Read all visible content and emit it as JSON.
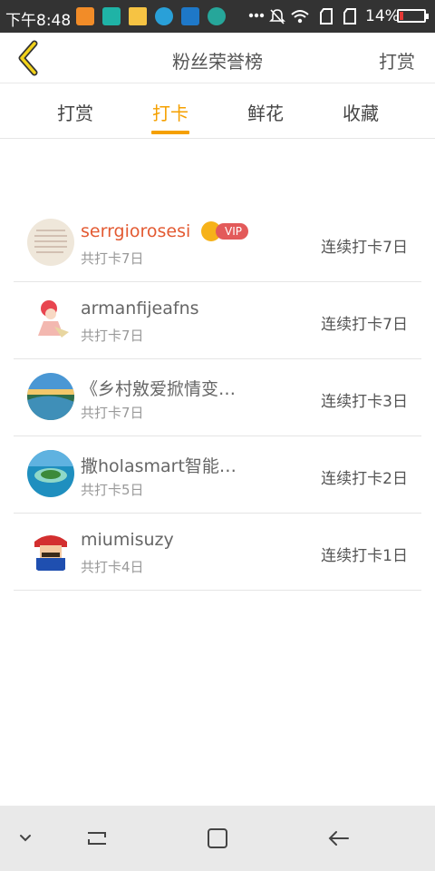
{
  "status_bar": {
    "time": "下午8:48",
    "battery_percent": "14%",
    "battery_level": 0.14,
    "colors": {
      "app1": "#f28c28",
      "app2": "#1fb3a6",
      "folder": "#f6c343",
      "palette": "#29a0d8",
      "weather": "#1e78c8",
      "app6": "#26a69a"
    }
  },
  "header": {
    "title": "粉丝荣誉榜",
    "right_action": "打赏"
  },
  "tabs": [
    {
      "label": "打赏"
    },
    {
      "label": "打卡",
      "active": true
    },
    {
      "label": "鲜花"
    },
    {
      "label": "收藏"
    }
  ],
  "accent_color": "#f5a000",
  "fans": [
    {
      "name": "serrgiorosesi",
      "vip": true,
      "vip_label": "VIP",
      "total": "共打卡7日",
      "streak": "连续打卡7日"
    },
    {
      "name": "armanfijeafns",
      "total": "共打卡7日",
      "streak": "连续打卡7日"
    },
    {
      "name": "《乡村敫爱掀情变…",
      "total": "共打卡7日",
      "streak": "连续打卡3日"
    },
    {
      "name": "撒holasmart智能…",
      "total": "共打卡5日",
      "streak": "连续打卡2日"
    },
    {
      "name": "miumisuzy",
      "total": "共打卡4日",
      "streak": "连续打卡1日"
    }
  ]
}
